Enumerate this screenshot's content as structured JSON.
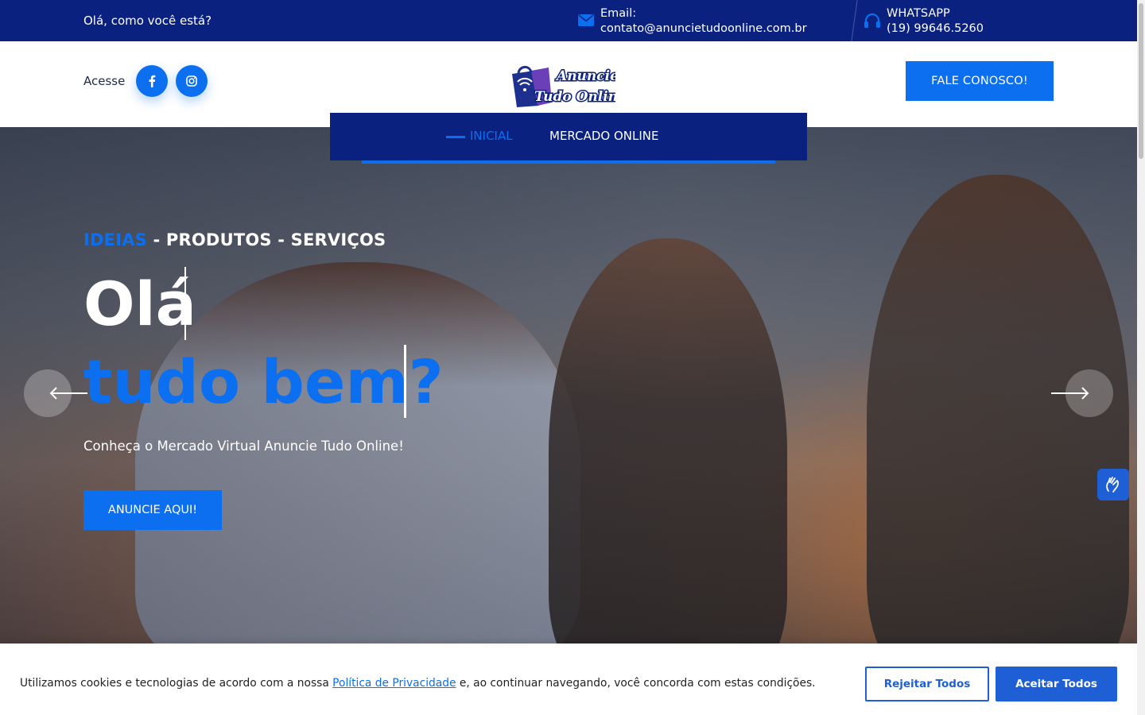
{
  "topbar": {
    "greeting": "Olá, como você está?",
    "email_label": "Email:",
    "email_value": "contato@anuncietudoonline.com.br",
    "whatsapp_label": "WHATSAPP",
    "whatsapp_value": "(19) 99646.5260"
  },
  "header": {
    "acesse_label": "Acesse",
    "logo_line1": "Anuncie",
    "logo_line2": "Tudo Online!",
    "cta_label": "FALE CONOSCO!"
  },
  "nav": {
    "items": [
      {
        "label": "INICIAL",
        "active": true
      },
      {
        "label": "MERCADO ONLINE",
        "active": false
      }
    ]
  },
  "hero": {
    "tagline_accent": "IDEIAS",
    "tagline_rest": " - PRODUTOS - SERVIÇOS",
    "headline_line1": "Olá",
    "headline_line2": "tudo bem?",
    "subtitle": "Conheça o Mercado Virtual Anuncie Tudo Online!",
    "button_label": "ANUNCIE AQUI!"
  },
  "cookie": {
    "text_before": "Utilizamos cookies e tecnologias de acordo com a nossa ",
    "link_text": "Política de Privacidade",
    "text_after": " e, ao continuar navegando, você concorda com estas condições.",
    "reject_label": "Rejeitar Todos",
    "accept_label": "Aceitar Todos"
  },
  "colors": {
    "navy": "#0a2180",
    "accent_blue": "#0b6ff0",
    "cookie_blue": "#1e5fd6"
  },
  "icons": [
    "envelope-icon",
    "headset-icon",
    "facebook-icon",
    "instagram-icon",
    "arrow-left-icon",
    "arrow-right-icon",
    "sign-language-icon"
  ]
}
